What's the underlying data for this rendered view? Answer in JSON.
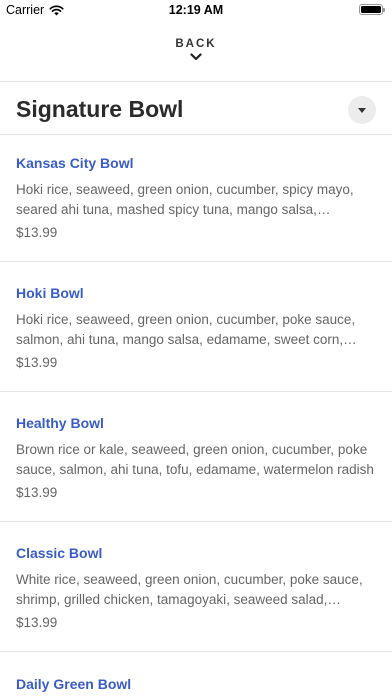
{
  "status_bar": {
    "carrier": "Carrier",
    "time": "12:19 AM"
  },
  "nav": {
    "back_label": "BACK"
  },
  "category": {
    "title": "Signature Bowl"
  },
  "items": [
    {
      "name": "Kansas City Bowl",
      "description": "Hoki rice, seaweed, green onion, cucumber, spicy mayo, seared ahi tuna, mashed spicy tuna, mango salsa, edamame",
      "price": "$13.99"
    },
    {
      "name": "Hoki Bowl",
      "description": "Hoki rice, seaweed, green onion, cucumber, poke sauce, salmon, ahi tuna, mango salsa, edamame, sweet corn, sesame",
      "price": "$13.99"
    },
    {
      "name": "Healthy Bowl",
      "description": "Brown rice or kale, seaweed, green onion, cucumber, poke sauce, salmon, ahi tuna, tofu, edamame, watermelon radish",
      "price": "$13.99"
    },
    {
      "name": "Classic Bowl",
      "description": "White rice, seaweed, green onion, cucumber, poke sauce, shrimp, grilled chicken, tamagoyaki, seaweed salad, edamame",
      "price": "$13.99"
    },
    {
      "name": "Daily Green Bowl",
      "description": "",
      "price": ""
    }
  ],
  "icons": {
    "wifi": "wifi-icon",
    "battery": "battery-icon",
    "back": "chevron-down-icon",
    "dropdown": "caret-down-icon"
  }
}
